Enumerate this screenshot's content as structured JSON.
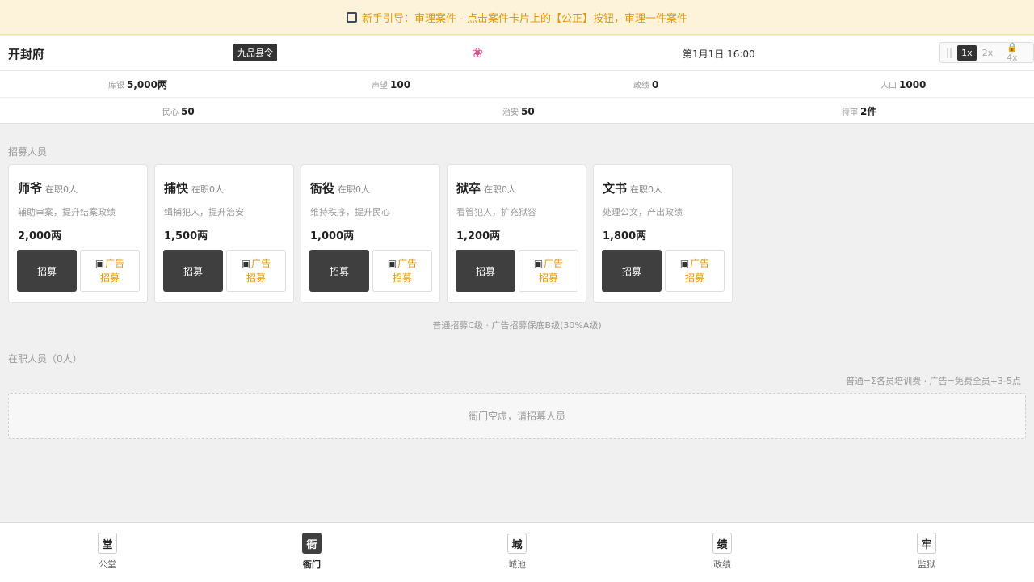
{
  "guide": {
    "text": "新手引导：审理案件 - 点击案件卡片上的【公正】按钮，审理一件案件"
  },
  "header": {
    "city": "开封府",
    "rank": "九品县令",
    "flower": "❀",
    "date": "第1月1日 16:00",
    "speed": {
      "pause": "||",
      "x1": "1x",
      "x2": "2x",
      "x4": "4x"
    }
  },
  "stats": [
    {
      "label": "库银",
      "value": "5,000两"
    },
    {
      "label": "声望",
      "value": "100"
    },
    {
      "label": "政绩",
      "value": "0"
    },
    {
      "label": "人口",
      "value": "1000"
    },
    {
      "label": "民心",
      "value": "50"
    },
    {
      "label": "治安",
      "value": "50"
    },
    {
      "label": "待审",
      "value": "2件"
    }
  ],
  "recruit": {
    "title": "招募人员",
    "cards": [
      {
        "name": "师爷",
        "status": "在职0人",
        "desc": "辅助审案，提升结案政绩",
        "price": "2,000两",
        "btn": "招募",
        "ad1": "广告",
        "ad2": "招募"
      },
      {
        "name": "捕快",
        "status": "在职0人",
        "desc": "缉捕犯人，提升治安",
        "price": "1,500两",
        "btn": "招募",
        "ad1": "广告",
        "ad2": "招募"
      },
      {
        "name": "衙役",
        "status": "在职0人",
        "desc": "维持秩序，提升民心",
        "price": "1,000两",
        "btn": "招募",
        "ad1": "广告",
        "ad2": "招募"
      },
      {
        "name": "狱卒",
        "status": "在职0人",
        "desc": "看管犯人，扩充狱容",
        "price": "1,200两",
        "btn": "招募",
        "ad1": "广告",
        "ad2": "招募"
      },
      {
        "name": "文书",
        "status": "在职0人",
        "desc": "处理公文，产出政绩",
        "price": "1,800两",
        "btn": "招募",
        "ad1": "广告",
        "ad2": "招募"
      }
    ],
    "note": "普通招募C级 · 广告招募保底B级(30%A级)"
  },
  "staff": {
    "title": "在职人员（0人）",
    "note": "普通=Σ各员培训费 · 广告=免费全员+3-5点",
    "empty": "衙门空虚，请招募人员"
  },
  "nav": [
    {
      "icon": "堂",
      "label": "公堂"
    },
    {
      "icon": "衙",
      "label": "衙门"
    },
    {
      "icon": "城",
      "label": "城池"
    },
    {
      "icon": "绩",
      "label": "政绩"
    },
    {
      "icon": "牢",
      "label": "监狱"
    }
  ]
}
